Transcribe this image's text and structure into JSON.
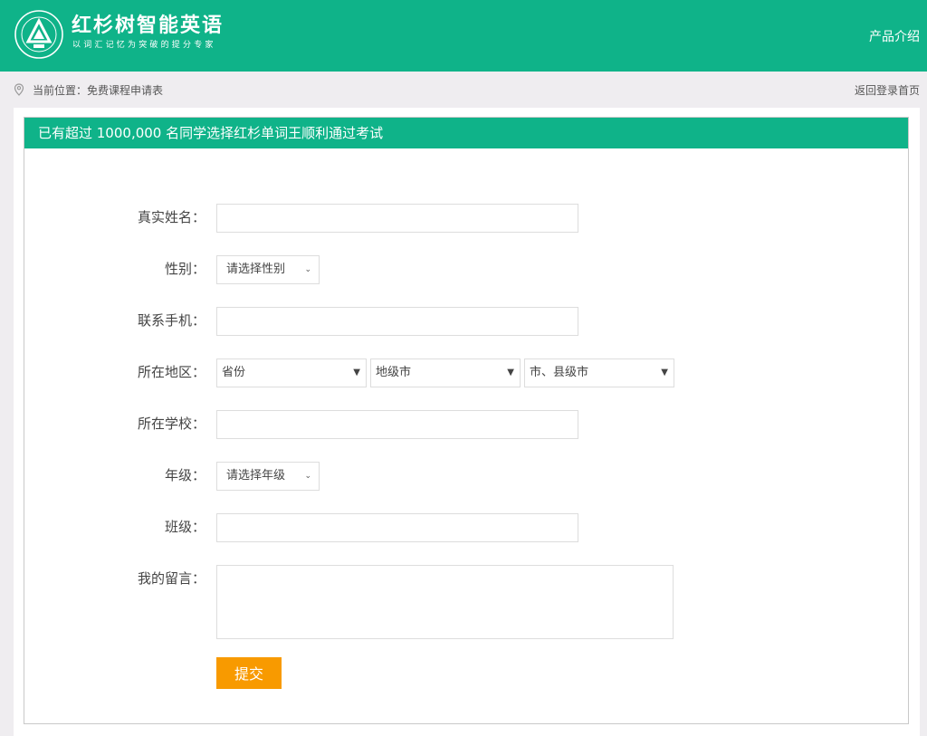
{
  "header": {
    "brand_title": "红杉树智能英语",
    "brand_subtitle": "以词汇记忆为突破的提分专家",
    "nav_product": "产品介绍"
  },
  "breadcrumb": {
    "label": "当前位置：",
    "current": "免费课程申请表",
    "back_link": "返回登录首页"
  },
  "card": {
    "title": "已有超过 1000,000 名同学选择红杉单词王顺利通过考试"
  },
  "form": {
    "name_label": "真实姓名：",
    "gender_label": "性别：",
    "gender_select": "请选择性别",
    "phone_label": "联系手机：",
    "region_label": "所在地区：",
    "province": "省份",
    "city": "地级市",
    "county": "市、县级市",
    "school_label": "所在学校：",
    "grade_label": "年级：",
    "grade_select": "请选择年级",
    "class_label": "班级：",
    "message_label": "我的留言：",
    "submit": "提交"
  },
  "colors": {
    "brand_green": "#0fb389",
    "submit_orange": "#f89a00",
    "page_bg": "#efedf0"
  }
}
